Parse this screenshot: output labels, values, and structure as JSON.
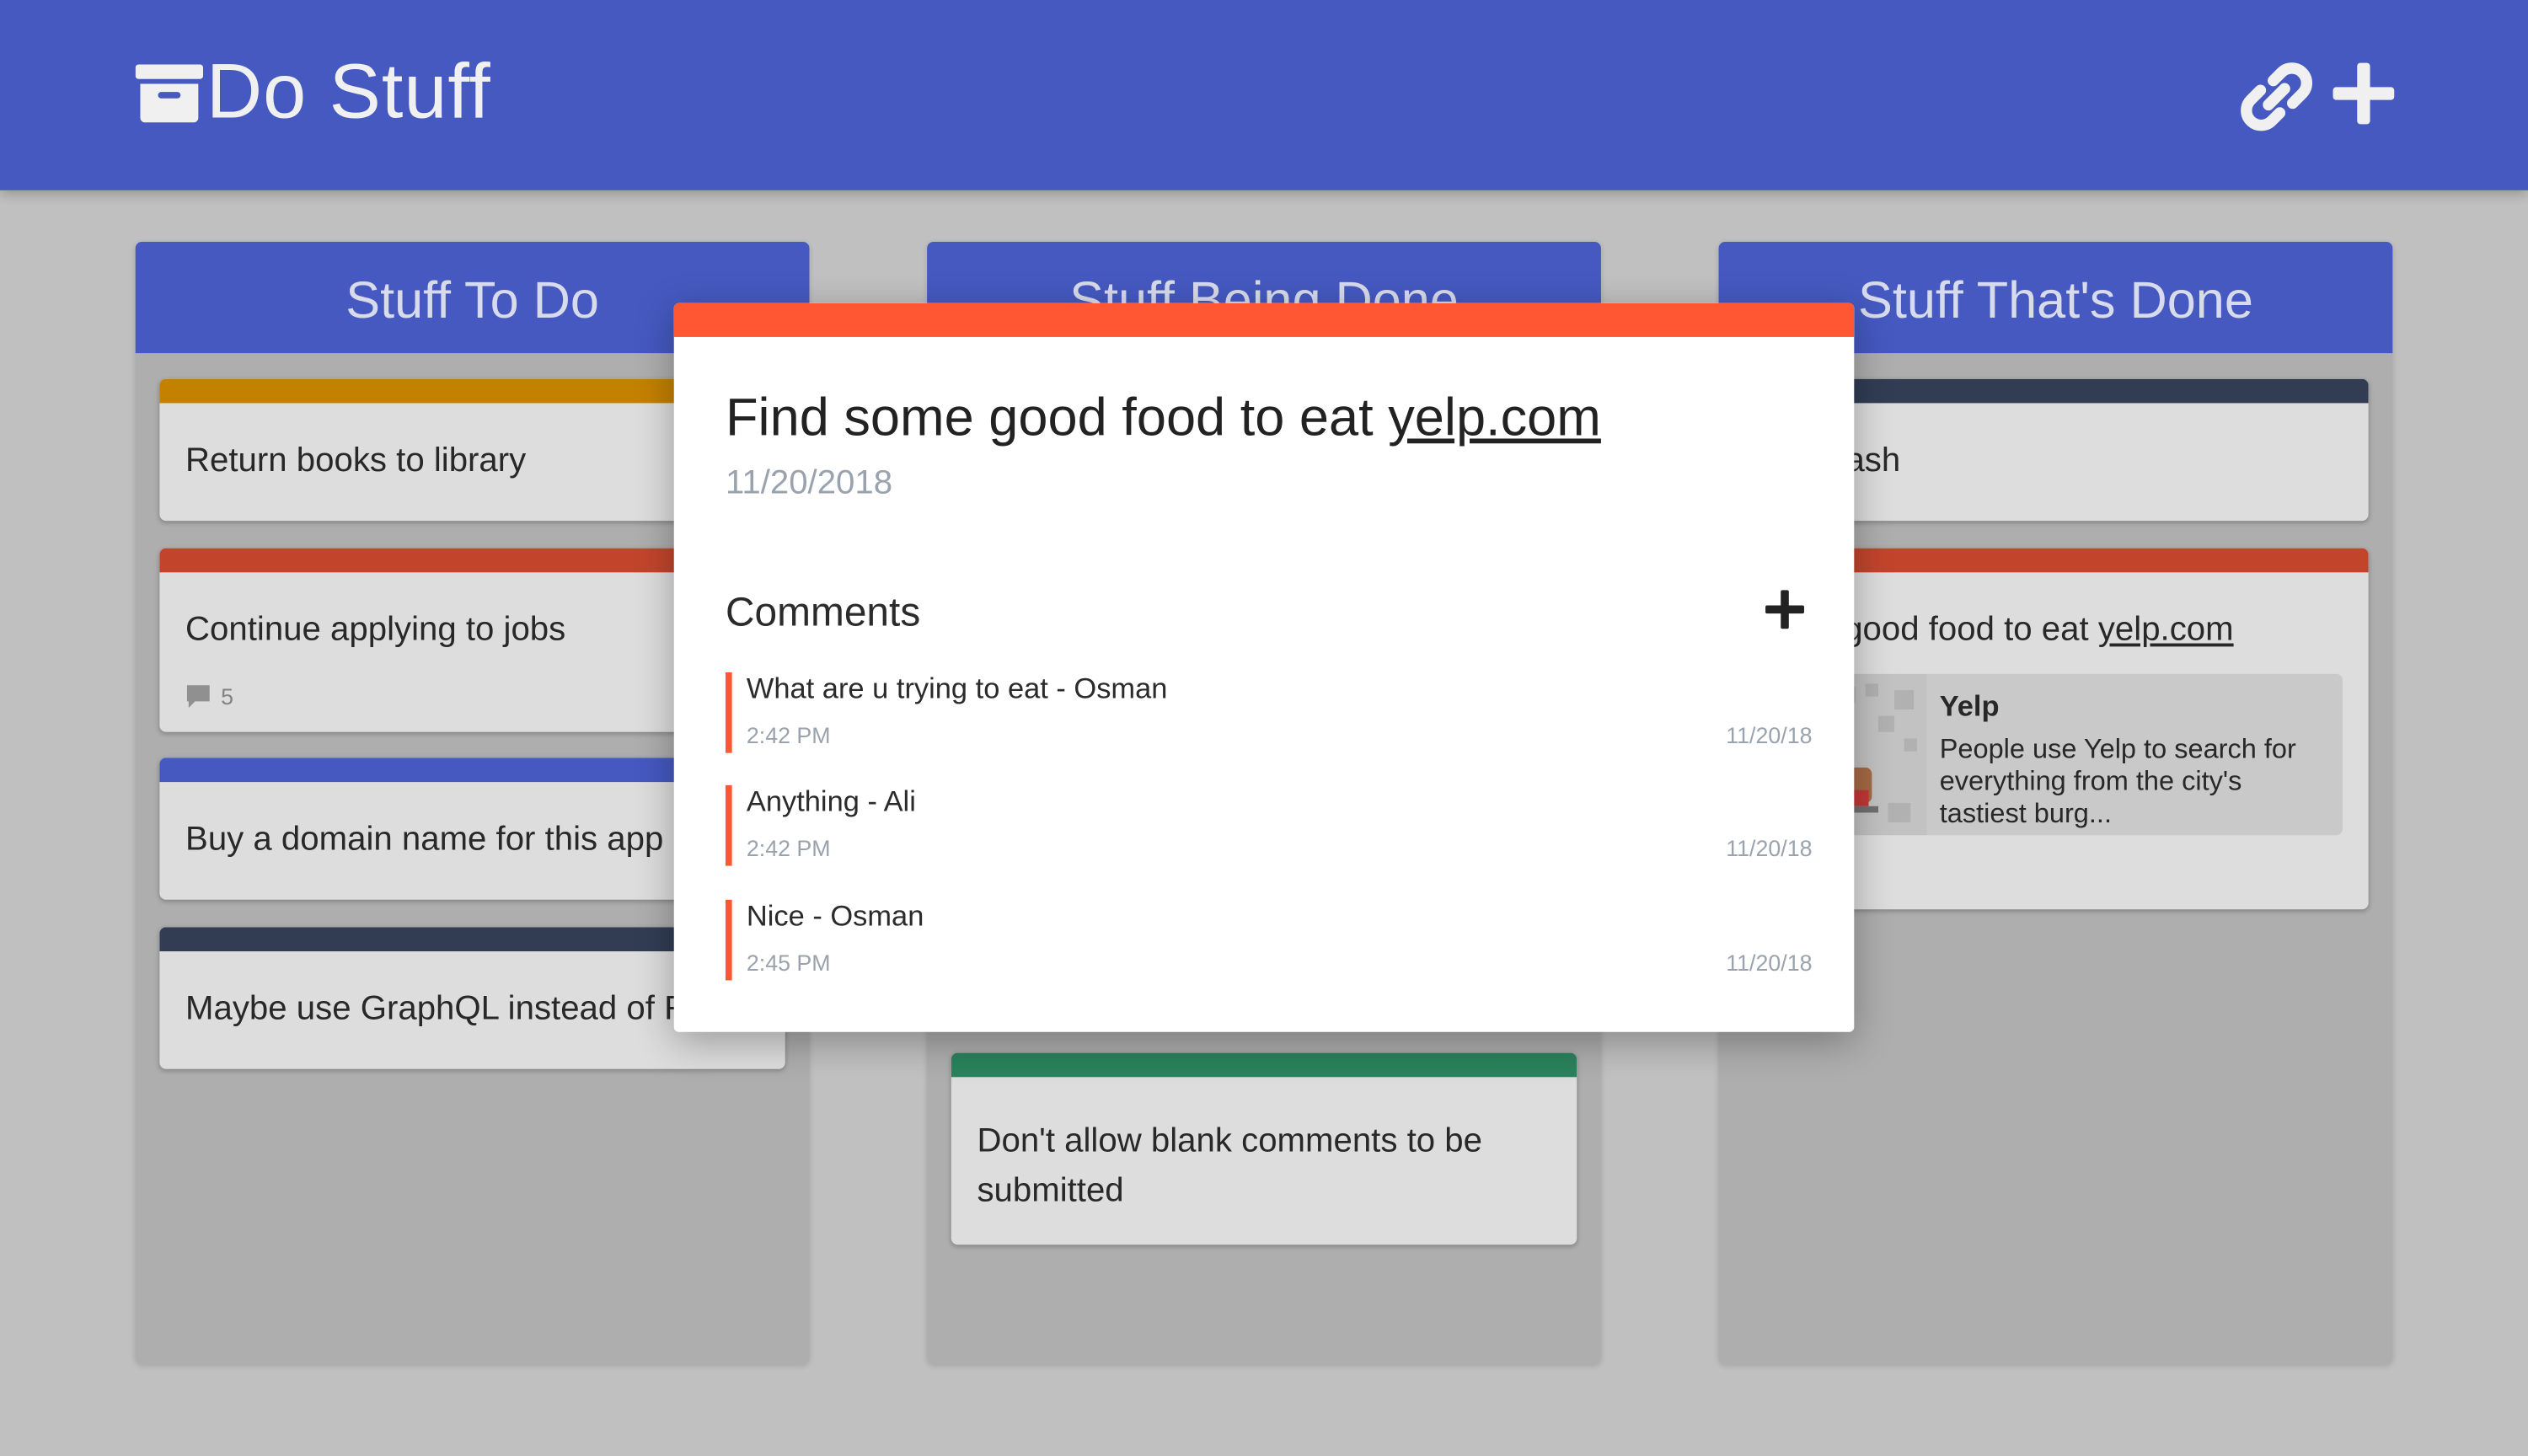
{
  "app": {
    "title": "Do Stuff"
  },
  "header": {
    "icons": {
      "logo": "archive-icon",
      "link": "link-icon",
      "add": "plus-icon"
    }
  },
  "columns": [
    {
      "title": "Stuff To Do",
      "cards": [
        {
          "text": "Return books to library",
          "color": "#d18a00"
        },
        {
          "text": "Continue applying to jobs",
          "color": "#cf4a2e",
          "comment_count": "5"
        },
        {
          "text": "Buy a domain name for this app",
          "color": "#4a5fce"
        },
        {
          "text": "Maybe use GraphQL instead of RE",
          "color": "#36415a"
        }
      ]
    },
    {
      "title": "Stuff Being Done",
      "cards": [
        {
          "text": "Don't allow blank comments to be submitted",
          "color": "#2e8b63"
        }
      ]
    },
    {
      "title": "Stuff That's Done",
      "cards": [
        {
          "text": "out trash",
          "color": "#36415a"
        },
        {
          "text": "ome good food to eat ",
          "link": "yelp.com",
          "color": "#cf4a2e",
          "preview": {
            "title": "Yelp",
            "description": "People use Yelp to search for everything from the city's tastiest burg..."
          }
        }
      ]
    }
  ],
  "modal": {
    "accent": "#ff5733",
    "title": "Find some good food to eat ",
    "link": "yelp.com",
    "date": "11/20/2018",
    "comments_heading": "Comments",
    "comments": [
      {
        "text": "What are u trying to eat - Osman",
        "time": "2:42 PM",
        "date": "11/20/18"
      },
      {
        "text": "Anything - Ali",
        "time": "2:42 PM",
        "date": "11/20/18"
      },
      {
        "text": "Nice - Osman",
        "time": "2:45 PM",
        "date": "11/20/18"
      }
    ]
  }
}
